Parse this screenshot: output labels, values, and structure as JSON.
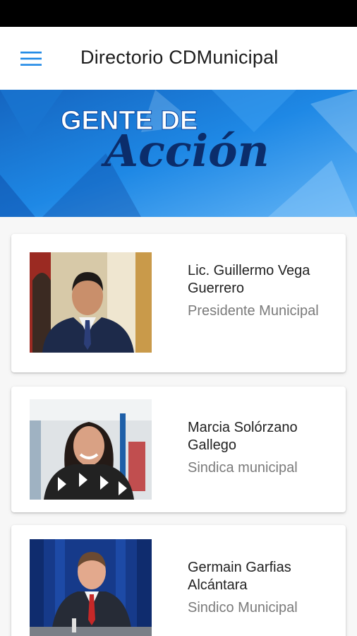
{
  "app_bar": {
    "title": "Directorio CDMunicipal",
    "menu_icon": "hamburger-menu-icon",
    "accent_color": "#1e88e5"
  },
  "banner": {
    "line1": "GENTE DE",
    "line2": "Acción",
    "bg_color": "#1a73d9"
  },
  "directory": [
    {
      "name": "Lic. Guillermo Vega Guerrero",
      "role": "Presidente Municipal"
    },
    {
      "name": "Marcia Solórzano Gallego",
      "role": "Sindica municipal"
    },
    {
      "name": "Germain Garfias Alcántara",
      "role": "Sindico Municipal"
    }
  ]
}
